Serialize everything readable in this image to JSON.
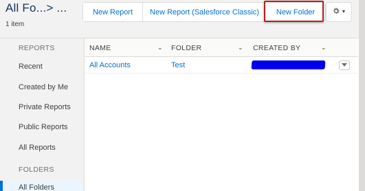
{
  "header": {
    "title": "All Fo...> ...",
    "item_count": "1 item",
    "buttons": {
      "new_report": "New Report",
      "new_report_classic": "New Report (Salesforce Classic)",
      "new_folder": "New Folder"
    },
    "settings_icon": "gear-icon",
    "highlight_color": "#b81c1c"
  },
  "sidebar": {
    "reports_heading": "REPORTS",
    "items": [
      {
        "label": "Recent"
      },
      {
        "label": "Created by Me"
      },
      {
        "label": "Private Reports"
      },
      {
        "label": "Public Reports"
      },
      {
        "label": "All Reports"
      }
    ],
    "folders_heading": "FOLDERS",
    "folder_items": [
      {
        "label": "All Folders",
        "active": true
      }
    ],
    "active_color": "#0070d2"
  },
  "table": {
    "columns": [
      {
        "label": "NAME"
      },
      {
        "label": "FOLDER"
      },
      {
        "label": "CREATED BY"
      }
    ],
    "rows": [
      {
        "name": "All Accounts",
        "folder": "Test",
        "created_by": ""
      }
    ]
  },
  "colors": {
    "link": "#0070d2",
    "redaction": "#0000ee"
  }
}
